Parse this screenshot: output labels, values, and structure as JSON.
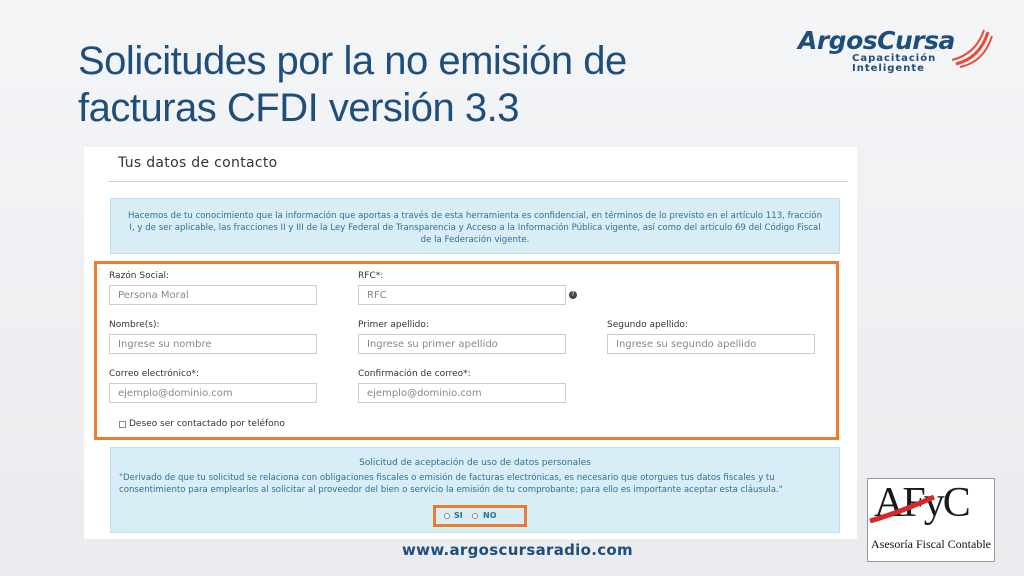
{
  "slide": {
    "title_line1": "Solicitudes por la no emisión de",
    "title_line2": "facturas CFDI versión 3.3",
    "footer_url": "www.argoscursaradio.com",
    "accent_color": "#ed7d31",
    "title_color": "#1f4e79"
  },
  "logos": {
    "argos_brand": "ArgosCursa",
    "argos_tag_line1": "Capacitación",
    "argos_tag_line2": "Inteligente",
    "afyc_mark": "AFyC",
    "afyc_subtitle": "Asesoría Fiscal Contable"
  },
  "form": {
    "heading": "Tus datos de contacto",
    "info_text": "Hacemos de tu conocimiento que la información que aportas a través de esta herramienta es confidencial, en términos de lo previsto en el artículo 113, fracción I, y de ser aplicable, las fracciones II y III de la Ley Federal de Transparencia y Acceso a la Información Pública vigente, así como del artículo 69 del Código Fiscal de la Federación vigente.",
    "fields": {
      "razon_social": {
        "label": "Razón Social:",
        "placeholder": "Persona Moral"
      },
      "rfc": {
        "label": "RFC*:",
        "placeholder": "RFC"
      },
      "nombre": {
        "label": "Nombre(s):",
        "placeholder": "Ingrese su nombre"
      },
      "primer_apellido": {
        "label": "Primer apellido:",
        "placeholder": "Ingrese su primer apellido"
      },
      "segundo_apellido": {
        "label": "Segundo apellido:",
        "placeholder": "Ingrese su segundo apellido"
      },
      "correo": {
        "label": "Correo electrónico*:",
        "placeholder": "ejemplo@dominio.com"
      },
      "confirmacion": {
        "label": "Confirmación de correo*:",
        "placeholder": "ejemplo@dominio.com"
      }
    },
    "checkbox_label": "Deseo ser contactado por teléfono",
    "consent": {
      "title": "Solicitud de aceptación de uso de datos personales",
      "text": "\"Derivado de que tu solicitud se relaciona con obligaciones fiscales o emisión de facturas electrónicas, es necesario que otorgues tus datos fiscales y tu consentimiento para emplearlos al solicitar al proveedor del bien o servicio la emisión de tu comprobante; para ello es importante aceptar esta cláusula.\"",
      "option_yes": "SI",
      "option_no": "NO"
    }
  }
}
